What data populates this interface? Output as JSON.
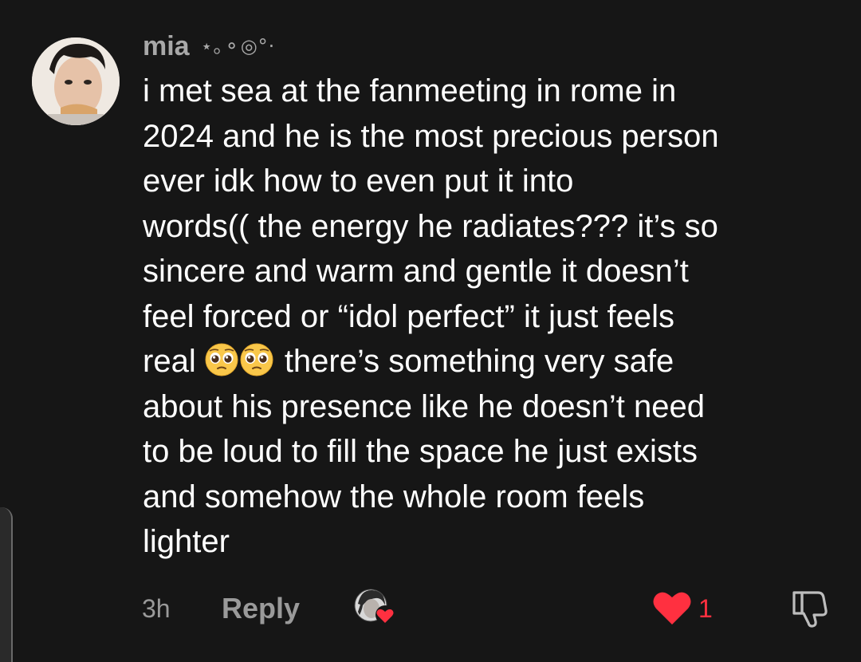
{
  "comment": {
    "username": "mia",
    "username_decoration": "⋆｡⚬◎°·",
    "lines": [
      "i met sea at the fanmeeting in rome in",
      "2024 and he is the most precious person",
      "ever idk how to even put it into",
      "words(( the energy he radiates??? it’s so",
      "sincere and warm and gentle it doesn’t",
      "feel forced or “idol perfect” it just feels"
    ],
    "emoji_line": {
      "before": "real ",
      "emojis": [
        "pleading-face",
        "pleading-face"
      ],
      "after": "there’s something very safe"
    },
    "lines_after": [
      "about his presence like he doesn’t need",
      "to be loud to fill the space he just exists",
      "and somehow the whole room feels",
      "lighter"
    ],
    "timestamp": "3h",
    "reply_label": "Reply",
    "like_count": "1",
    "liked": true
  },
  "colors": {
    "background": "#161616",
    "text": "#ffffff",
    "muted": "#9a9a9a",
    "like": "#ff3040"
  },
  "icons": {
    "author_avatar": "author-avatar",
    "liked_by_creator": "creator-liked-avatar-icon",
    "like": "heart-icon",
    "dislike": "thumbs-down-icon"
  }
}
